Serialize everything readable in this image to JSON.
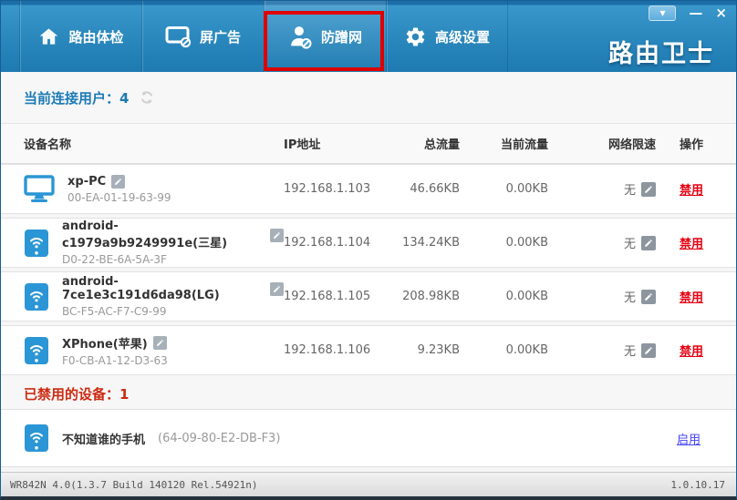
{
  "window": {
    "logo": "路由卫士",
    "controls": {
      "menu_glyph": "▼",
      "minimize_glyph": "—",
      "close_glyph": "×"
    },
    "statusbar": {
      "left": "WR842N 4.0(1.3.7 Build 140120 Rel.54921n)",
      "right": "1.0.10.17"
    }
  },
  "nav": {
    "tabs": [
      {
        "label": "路由体检",
        "icon": "home-icon",
        "active": false
      },
      {
        "label": "屏广告",
        "icon": "screen-block-icon",
        "active": false
      },
      {
        "label": "防蹭网",
        "icon": "person-block-icon",
        "active": true,
        "highlighted": true
      },
      {
        "label": "高级设置",
        "icon": "gear-icon",
        "active": false
      }
    ]
  },
  "connected": {
    "title": "当前连接用户：4"
  },
  "table": {
    "headers": [
      "设备名称",
      "IP地址",
      "总流量",
      "当前流量",
      "网络限速",
      "操作"
    ],
    "rows": [
      {
        "device_type": "pc",
        "name": "xp-PC",
        "mac": "00-EA-01-19-63-99",
        "ip": "192.168.1.103",
        "total": "46.66KB",
        "current": "0.00KB",
        "limit": "无",
        "action": "禁用"
      },
      {
        "device_type": "phone",
        "name": "android-c1979a9b9249991e(三星)",
        "mac": "D0-22-BE-6A-5A-3F",
        "ip": "192.168.1.104",
        "total": "134.24KB",
        "current": "0.00KB",
        "limit": "无",
        "action": "禁用"
      },
      {
        "device_type": "phone",
        "name": "android-7ce1e3c191d6da98(LG)",
        "mac": "BC-F5-AC-F7-C9-99",
        "ip": "192.168.1.105",
        "total": "208.98KB",
        "current": "0.00KB",
        "limit": "无",
        "action": "禁用"
      },
      {
        "device_type": "phone",
        "name": "XPhone(苹果)",
        "mac": "F0-CB-A1-12-D3-63",
        "ip": "192.168.1.106",
        "total": "9.23KB",
        "current": "0.00KB",
        "limit": "无",
        "action": "禁用"
      }
    ]
  },
  "disabled": {
    "title": "已禁用的设备：1",
    "rows": [
      {
        "device_type": "phone",
        "name": "不知道谁的手机",
        "mac": "(64-09-80-E2-DB-F3)",
        "action": "启用"
      }
    ]
  },
  "colors": {
    "accent_blue": "#2b8cc4",
    "disable_link": "#e60012",
    "enable_link": "#4040ff",
    "disabled_title": "#cc2b12",
    "highlight_border": "#de0000"
  }
}
